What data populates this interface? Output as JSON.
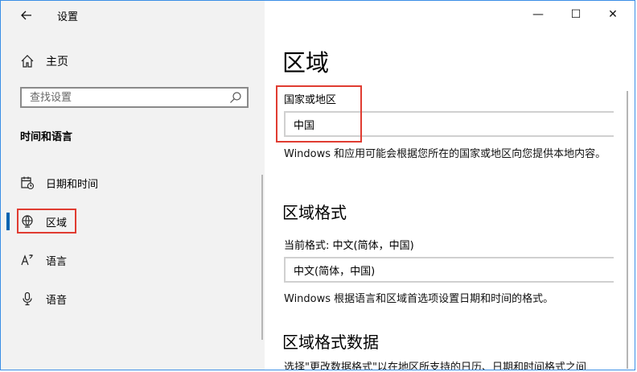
{
  "window": {
    "title": "设置",
    "back_icon": "arrow-left-icon",
    "controls": {
      "minimize": "—",
      "maximize": "☐",
      "close": "✕"
    }
  },
  "sidebar": {
    "home_label": "主页",
    "search_placeholder": "查找设置",
    "section_title": "时间和语言",
    "items": [
      {
        "label": "日期和时间",
        "icon": "calendar-clock-icon",
        "selected": false
      },
      {
        "label": "区域",
        "icon": "globe-region-icon",
        "selected": true
      },
      {
        "label": "语言",
        "icon": "language-icon",
        "selected": false
      },
      {
        "label": "语音",
        "icon": "microphone-icon",
        "selected": false
      }
    ]
  },
  "main": {
    "title": "区域",
    "country_label": "国家或地区",
    "country_value": "中国",
    "country_desc": "Windows 和应用可能会根据您所在的国家或地区向您提供本地内容。",
    "format_heading": "区域格式",
    "format_label": "当前格式: 中文(简体，中国)",
    "format_value": "中文(简体，中国)",
    "format_desc": "Windows 根据语言和区域首选项设置日期和时间的格式。",
    "format_data_heading": "区域格式数据",
    "format_data_desc_partial": "选择\"更改数据格式\"以在地区所支持的日历、日期和时间格式之间"
  },
  "colors": {
    "accent": "#0063b1",
    "highlight_box": "#e03c31",
    "sidebar_bg": "#f2f2f2"
  }
}
